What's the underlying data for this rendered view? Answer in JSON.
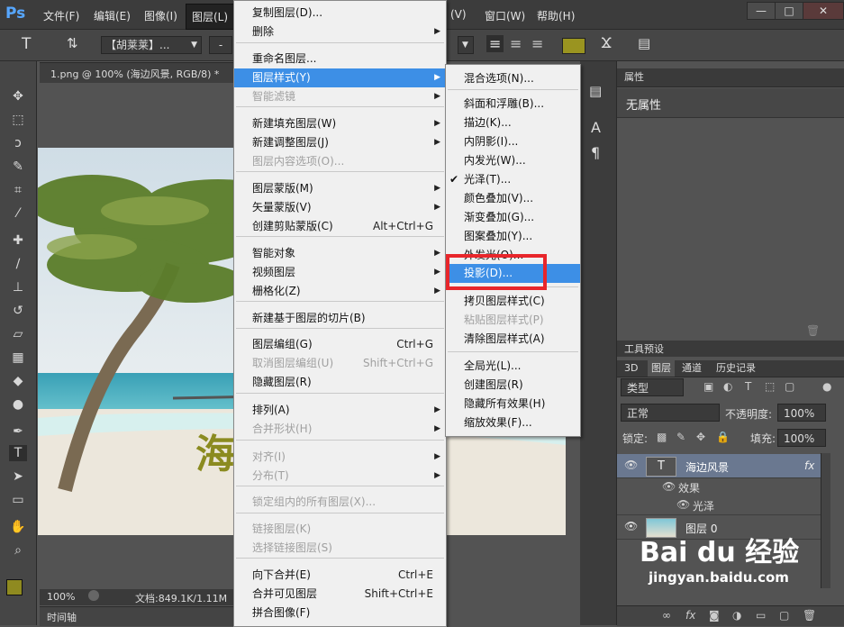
{
  "app": {
    "logo": "Ps"
  },
  "menubar": {
    "items": [
      "文件(F)",
      "编辑(E)",
      "图像(I)",
      "图层(L)",
      "(V)",
      "窗口(W)",
      "帮助(H)"
    ]
  },
  "window_controls": {
    "minimize": "—",
    "restore": "□",
    "close": "✕"
  },
  "options": {
    "text_tool_glyph": "T",
    "font_family": "【胡莱莱】...",
    "font_style": "-",
    "align_left": "≡",
    "align_center": "≡",
    "align_right": "≡",
    "text_color": "#9a9420"
  },
  "document_tab": {
    "title": "1.png @ 100% (海边风景, RGB/8) *",
    "close": "×"
  },
  "canvas": {
    "visible_text": "海  景"
  },
  "status": {
    "zoom": "100%",
    "doc_info": "文档:849.1K/1.11M"
  },
  "timeline": {
    "label": "时间轴"
  },
  "layer_menu": {
    "items": [
      {
        "label": "复制图层(D)...",
        "shortcut": "",
        "disabled": false,
        "submenu": false
      },
      {
        "label": "删除",
        "shortcut": "",
        "disabled": false,
        "submenu": true
      },
      {
        "label": "重命名图层...",
        "shortcut": "",
        "disabled": false,
        "submenu": false
      },
      {
        "label": "图层样式(Y)",
        "shortcut": "",
        "disabled": false,
        "submenu": true,
        "highlighted": true
      },
      {
        "label": "智能滤镜",
        "shortcut": "",
        "disabled": true,
        "submenu": true
      },
      {
        "label": "新建填充图层(W)",
        "shortcut": "",
        "disabled": false,
        "submenu": true
      },
      {
        "label": "新建调整图层(J)",
        "shortcut": "",
        "disabled": false,
        "submenu": true
      },
      {
        "label": "图层内容选项(O)...",
        "shortcut": "",
        "disabled": true,
        "submenu": false
      },
      {
        "label": "图层蒙版(M)",
        "shortcut": "",
        "disabled": false,
        "submenu": true
      },
      {
        "label": "矢量蒙版(V)",
        "shortcut": "",
        "disabled": false,
        "submenu": true
      },
      {
        "label": "创建剪贴蒙版(C)",
        "shortcut": "Alt+Ctrl+G",
        "disabled": false,
        "submenu": false
      },
      {
        "label": "智能对象",
        "shortcut": "",
        "disabled": false,
        "submenu": true
      },
      {
        "label": "视频图层",
        "shortcut": "",
        "disabled": false,
        "submenu": true
      },
      {
        "label": "栅格化(Z)",
        "shortcut": "",
        "disabled": false,
        "submenu": true
      },
      {
        "label": "新建基于图层的切片(B)",
        "shortcut": "",
        "disabled": false,
        "submenu": false
      },
      {
        "label": "图层编组(G)",
        "shortcut": "Ctrl+G",
        "disabled": false,
        "submenu": false
      },
      {
        "label": "取消图层编组(U)",
        "shortcut": "Shift+Ctrl+G",
        "disabled": true,
        "submenu": false
      },
      {
        "label": "隐藏图层(R)",
        "shortcut": "",
        "disabled": false,
        "submenu": false
      },
      {
        "label": "排列(A)",
        "shortcut": "",
        "disabled": false,
        "submenu": true
      },
      {
        "label": "合并形状(H)",
        "shortcut": "",
        "disabled": true,
        "submenu": true
      },
      {
        "label": "对齐(I)",
        "shortcut": "",
        "disabled": true,
        "submenu": true
      },
      {
        "label": "分布(T)",
        "shortcut": "",
        "disabled": true,
        "submenu": true
      },
      {
        "label": "锁定组内的所有图层(X)...",
        "shortcut": "",
        "disabled": true,
        "submenu": false
      },
      {
        "label": "链接图层(K)",
        "shortcut": "",
        "disabled": true,
        "submenu": false
      },
      {
        "label": "选择链接图层(S)",
        "shortcut": "",
        "disabled": true,
        "submenu": false
      },
      {
        "label": "向下合并(E)",
        "shortcut": "Ctrl+E",
        "disabled": false,
        "submenu": false
      },
      {
        "label": "合并可见图层",
        "shortcut": "Shift+Ctrl+E",
        "disabled": false,
        "submenu": false
      },
      {
        "label": "拼合图像(F)",
        "shortcut": "",
        "disabled": false,
        "submenu": false
      }
    ]
  },
  "style_menu": {
    "items": [
      {
        "label": "混合选项(N)...",
        "checked": false,
        "highlighted": false
      },
      {
        "label": "斜面和浮雕(B)...",
        "checked": false,
        "highlighted": false
      },
      {
        "label": "描边(K)...",
        "checked": false,
        "highlighted": false
      },
      {
        "label": "内阴影(I)...",
        "checked": false,
        "highlighted": false
      },
      {
        "label": "内发光(W)...",
        "checked": false,
        "highlighted": false
      },
      {
        "label": "光泽(T)...",
        "checked": true,
        "highlighted": false
      },
      {
        "label": "颜色叠加(V)...",
        "checked": false,
        "highlighted": false
      },
      {
        "label": "渐变叠加(G)...",
        "checked": false,
        "highlighted": false
      },
      {
        "label": "图案叠加(Y)...",
        "checked": false,
        "highlighted": false
      },
      {
        "label": "外发光(O)...",
        "checked": false,
        "highlighted": false
      },
      {
        "label": "投影(D)...",
        "checked": false,
        "highlighted": true
      },
      {
        "label": "拷贝图层样式(C)",
        "checked": false,
        "highlighted": false
      },
      {
        "label": "粘贴图层样式(P)",
        "checked": false,
        "highlighted": false,
        "disabled": true
      },
      {
        "label": "清除图层样式(A)",
        "checked": false,
        "highlighted": false
      },
      {
        "label": "全局光(L)...",
        "checked": false,
        "highlighted": false
      },
      {
        "label": "创建图层(R)",
        "checked": false,
        "highlighted": false
      },
      {
        "label": "隐藏所有效果(H)",
        "checked": false,
        "highlighted": false
      },
      {
        "label": "缩放效果(F)...",
        "checked": false,
        "highlighted": false
      }
    ],
    "check_mark": "✔"
  },
  "properties_panel": {
    "title": "属性",
    "content": "无属性"
  },
  "tool_presets": {
    "title": "工具预设"
  },
  "layers_panel": {
    "tabs": [
      "3D",
      "图层",
      "通道",
      "历史记录"
    ],
    "filter_kind": "类型",
    "blend_mode": "正常",
    "opacity_label": "不透明度:",
    "opacity_value": "100%",
    "lock_label": "锁定:",
    "fill_label": "填充:",
    "fill_value": "100%",
    "layers": [
      {
        "name": "海边风景",
        "thumb": "T",
        "fx": "fx"
      },
      {
        "name": "效果"
      },
      {
        "name": "光泽"
      },
      {
        "name": "图层 0"
      }
    ]
  },
  "watermark": {
    "brand": "Bai du 经验",
    "url": "jingyan.baidu.com"
  },
  "colors": {
    "accent": "#3d8fe6",
    "highlight_box": "#e8262b",
    "fg_swatch": "#8f8a20"
  }
}
